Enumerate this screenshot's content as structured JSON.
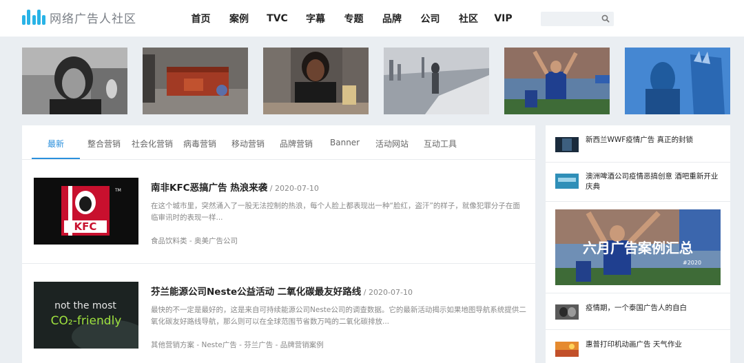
{
  "header": {
    "logo_text": "网络广告人社区",
    "nav": [
      "首页",
      "案例",
      "TVC",
      "字幕",
      "专题",
      "品牌",
      "公司",
      "社区",
      "VIP"
    ],
    "search": {
      "placeholder": ""
    }
  },
  "tabs": [
    "最新",
    "整合营销",
    "社会化营销",
    "病毒营销",
    "移动营销",
    "品牌营销",
    "Banner",
    "活动网站",
    "互动工具"
  ],
  "articles": [
    {
      "title": "南非KFC恶搞广告 热浪来袭",
      "date": " / 2020-07-10",
      "desc": "在这个城市里，突然涌入了一股无法控制的热浪，每个人脸上都表现出一种“脸红，盗汗”的样子，就像犯罪分子在面临审讯时的表现一样...",
      "tags": "食品饮料类  - 奥美广告公司",
      "image_text": "KFC"
    },
    {
      "title": "芬兰能源公司Neste公益活动 二氧化碳最友好路线",
      "date": " / 2020-07-10",
      "desc": "最快的不一定是最好的，这是来自可持续能源公司Neste公司的调查数据。它的最新活动揭示如果地图导航系统提供二氧化碳友好路线导航，那么则可以在全球范围节省数万吨的二氧化碳排放...",
      "tags": "其他营销方案 - Neste广告 - 芬兰广告 - 品牌营销案例",
      "image_text_1": "not the most",
      "image_text_2": "CO₂-friendly"
    }
  ],
  "sidebar": {
    "items": [
      {
        "text": "新西兰WWF疫情广告 真正的封锁"
      },
      {
        "text": "澳洲啤酒公司疫情恶搞创意 酒吧重新开业庆典"
      },
      {
        "text": "疫情期，一个泰国广告人的自白"
      },
      {
        "text": "惠普打印机动画广告 天气作业"
      }
    ],
    "feature": {
      "title": "六月广告案例汇总",
      "tag": "#2020"
    }
  },
  "colors": {
    "accent": "#2a8fdc",
    "logo": "#29b3e6"
  }
}
